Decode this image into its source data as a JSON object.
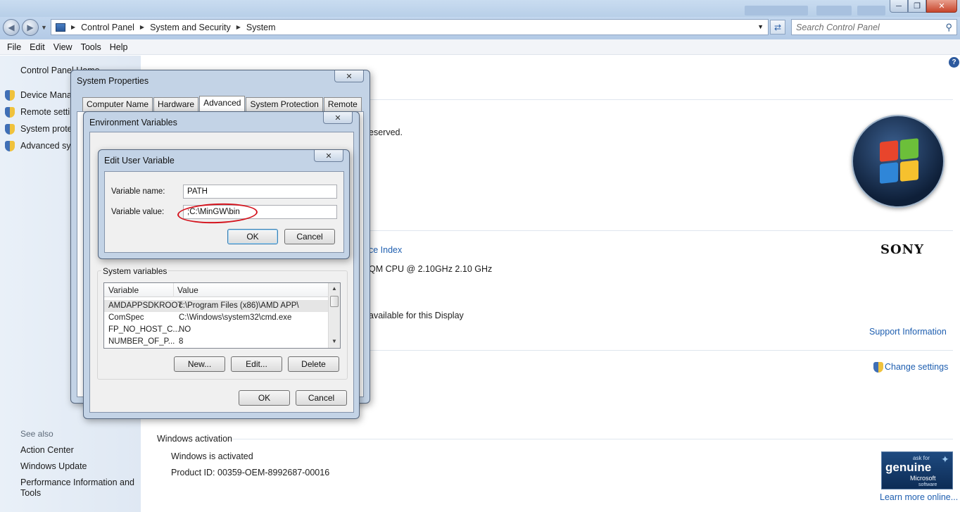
{
  "window": {
    "breadcrumbs": [
      "Control Panel",
      "System and Security",
      "System"
    ],
    "search_placeholder": "Search Control Panel"
  },
  "menu": [
    "File",
    "Edit",
    "View",
    "Tools",
    "Help"
  ],
  "left_nav": {
    "home": "Control Panel Home",
    "items": [
      "Device Manag",
      "Remote settin",
      "System prote",
      "Advanced sys"
    ],
    "see_also_title": "See also",
    "see_also": [
      "Action Center",
      "Windows Update",
      "Performance Information and",
      "Tools"
    ]
  },
  "main": {
    "copyright_fragment": "eserved.",
    "rating_link": "ce Index",
    "cpu": "QM CPU @ 2.10GHz   2.10 GHz",
    "pen_touch": "available for this Display",
    "support_link": "Support Information",
    "change_settings": "Change settings",
    "activation_header": "Windows activation",
    "activated": "Windows is activated",
    "product_id": "Product ID:  00359-OEM-8992687-00016",
    "learn_more": "Learn more online...",
    "oem_logo": "SONY",
    "genuine_badge": {
      "ask": "ask for",
      "genuine": "genuine",
      "microsoft": "Microsoft",
      "software": "software"
    }
  },
  "system_properties": {
    "title": "System Properties",
    "tabs": [
      "Computer Name",
      "Hardware",
      "Advanced",
      "System Protection",
      "Remote"
    ],
    "active_tab": "Advanced"
  },
  "environment_variables": {
    "title": "Environment Variables",
    "system_group": "System variables",
    "columns": [
      "Variable",
      "Value"
    ],
    "rows": [
      {
        "variable": "AMDAPPSDKROOT",
        "value": "c:\\Program Files (x86)\\AMD APP\\"
      },
      {
        "variable": "ComSpec",
        "value": "C:\\Windows\\system32\\cmd.exe"
      },
      {
        "variable": "FP_NO_HOST_C...",
        "value": "NO"
      },
      {
        "variable": "NUMBER_OF_P...",
        "value": "8"
      }
    ],
    "buttons": {
      "new": "New...",
      "edit": "Edit...",
      "delete": "Delete",
      "ok": "OK",
      "cancel": "Cancel"
    }
  },
  "edit_user_variable": {
    "title": "Edit User Variable",
    "name_label": "Variable name:",
    "name_value": "PATH",
    "value_label": "Variable value:",
    "value_value": ";C:\\MinGW\\bin",
    "ok": "OK",
    "cancel": "Cancel"
  },
  "colors": {
    "link": "#1f5fb0",
    "annotation": "#d4141e",
    "dialog_frame": "#c3d3e6"
  }
}
